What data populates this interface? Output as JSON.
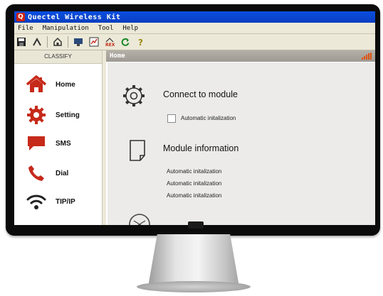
{
  "window": {
    "title": "Quectel Wireless Kit"
  },
  "menu": [
    "File",
    "Manipulation",
    "Tool",
    "Help"
  ],
  "toolbar_icons": [
    "save-icon",
    "tools-icon",
    "home-icon",
    "monitor-icon",
    "chart-icon",
    "rex-icon",
    "refresh-icon",
    "help-icon"
  ],
  "sidebar": {
    "header": "CLASSIFY",
    "items": [
      {
        "label": "Home",
        "icon": "home-icon"
      },
      {
        "label": "Setting",
        "icon": "gear-icon"
      },
      {
        "label": "SMS",
        "icon": "message-icon"
      },
      {
        "label": "Dial",
        "icon": "phone-icon"
      },
      {
        "label": "TIP/IP",
        "icon": "wifi-icon"
      }
    ]
  },
  "main": {
    "title": "Home",
    "connect": {
      "title": "Connect to module",
      "checkbox_label": "Automatic initalization",
      "checked": false
    },
    "module_info": {
      "title": "Module information",
      "lines": [
        "Automatic initalization",
        "Automatic initalization",
        "Automatic initalization"
      ]
    }
  },
  "colors": {
    "titlebar": "#0a4ee0",
    "accent": "#e0520e",
    "icon_red": "#c62a1a"
  }
}
